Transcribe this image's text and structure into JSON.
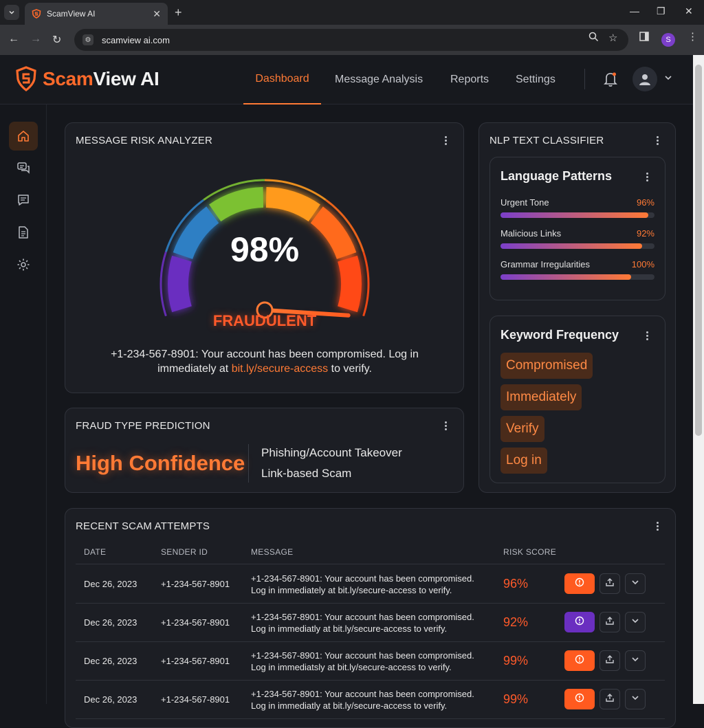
{
  "browser": {
    "tab_title": "ScamView AI",
    "url": "scamview ai.com",
    "profile_initial": "S"
  },
  "app": {
    "logo_part1": "Scam",
    "logo_part2": "View AI",
    "nav": [
      "Dashboard",
      "Message Analysis",
      "Reports",
      "Settings"
    ],
    "active_nav": "Dashboard"
  },
  "sidebar": {
    "items": [
      "home-icon",
      "chat-bubbles-icon",
      "message-icon",
      "document-icon",
      "gear-icon"
    ],
    "active": "home-icon"
  },
  "risk_analyzer": {
    "title": "MESSAGE RISK ANALYZER",
    "score": "98%",
    "score_value": 98,
    "verdict": "FRAUDULENT",
    "message_prefix": "+1-234-567-8901: Your account has been compromised. Log in immediately at ",
    "message_link": "bit.ly/secure-access",
    "message_suffix": " to verify."
  },
  "fraud_prediction": {
    "title": "FRAUD TYPE PREDICTION",
    "confidence": "High Confidence",
    "types": [
      "Phishing/Account Takeover",
      "Link-based Scam"
    ]
  },
  "nlp": {
    "title": "NLP TEXT CLASSIFIER",
    "language_patterns": {
      "title": "Language Patterns",
      "items": [
        {
          "name": "Urgent Tone",
          "value": "96%",
          "fill": 0.96
        },
        {
          "name": "Malicious Links",
          "value": "92%",
          "fill": 0.92
        },
        {
          "name": "Grammar Irregularities",
          "value": "100%",
          "fill": 0.85
        }
      ]
    },
    "keyword_frequency": {
      "title": "Keyword Frequency",
      "keywords": [
        "Compromised",
        "Immediately",
        "Verify",
        "Log in"
      ]
    }
  },
  "recent": {
    "title": "RECENT SCAM ATTEMPTS",
    "columns": [
      "DATE",
      "SENDER ID",
      "MESSAGE",
      "RISK SCORE"
    ],
    "rows": [
      {
        "date": "Dec 26, 2023",
        "sender": "+1-234-567-8901",
        "message": "+1-234-567-8901: Your account has been compromised. Log in immediately at bit.ly/secure-access to verify.",
        "risk": "96%",
        "action_color": "#ff5a1f"
      },
      {
        "date": "Dec 26, 2023",
        "sender": "+1-234-567-8901",
        "message": "+1-234-567-8901: Your account has been compromised. Log in immediatly at bit.ly/secure-access to verify.",
        "risk": "92%",
        "action_color": "#6a2fc0"
      },
      {
        "date": "Dec 26, 2023",
        "sender": "+1-234-567-8901",
        "message": "+1-234-567-8901: Your account has been compromised. Log in immediatsly at bit.ly/secure-access to verify.",
        "risk": "99%",
        "action_color": "#ff5a1f"
      },
      {
        "date": "Dec 26, 2023",
        "sender": "+1-234-567-8901",
        "message": "+1-234-567-8901: Your account has been compromised. Log in immediatly at bit.ly/secure-access to verify.",
        "risk": "99%",
        "action_color": "#ff5a1f"
      }
    ]
  },
  "colors": {
    "accent": "#ff7a35",
    "danger": "#ff5a2a",
    "purple": "#7b3fc9"
  }
}
